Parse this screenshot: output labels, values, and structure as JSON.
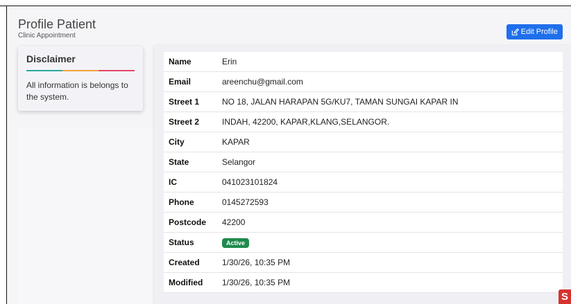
{
  "header": {
    "title": "Profile Patient",
    "subtitle": "Clinic Appointment",
    "edit_label": "Edit Profile"
  },
  "disclaimer": {
    "title": "Disclaimer",
    "text": "All information is belongs to the system.",
    "bar_colors": [
      "#2aa7a0",
      "#f1a33b",
      "#e2476a"
    ]
  },
  "profile": {
    "rows": [
      {
        "label": "Name",
        "value": "Erin"
      },
      {
        "label": "Email",
        "value": "areenchu@gmail.com"
      },
      {
        "label": "Street 1",
        "value": "NO 18, JALAN HARAPAN 5G/KU7, TAMAN SUNGAI KAPAR IN"
      },
      {
        "label": "Street 2",
        "value": "INDAH, 42200, KAPAR,KLANG,SELANGOR."
      },
      {
        "label": "City",
        "value": "KAPAR"
      },
      {
        "label": "State",
        "value": "Selangor"
      },
      {
        "label": "IC",
        "value": "041023101824"
      },
      {
        "label": "Phone",
        "value": "0145272593"
      },
      {
        "label": "Postcode",
        "value": "42200"
      },
      {
        "label": "Status",
        "value": "Active"
      },
      {
        "label": "Created",
        "value": "1/30/26, 10:35 PM"
      },
      {
        "label": "Modified",
        "value": "1/30/26, 10:35 PM"
      }
    ]
  },
  "colors": {
    "primary": "#1f6feb",
    "active_badge": "#1f8a4c"
  },
  "icons": {
    "edit": "edit-icon",
    "corner": "corner-logo-icon"
  }
}
